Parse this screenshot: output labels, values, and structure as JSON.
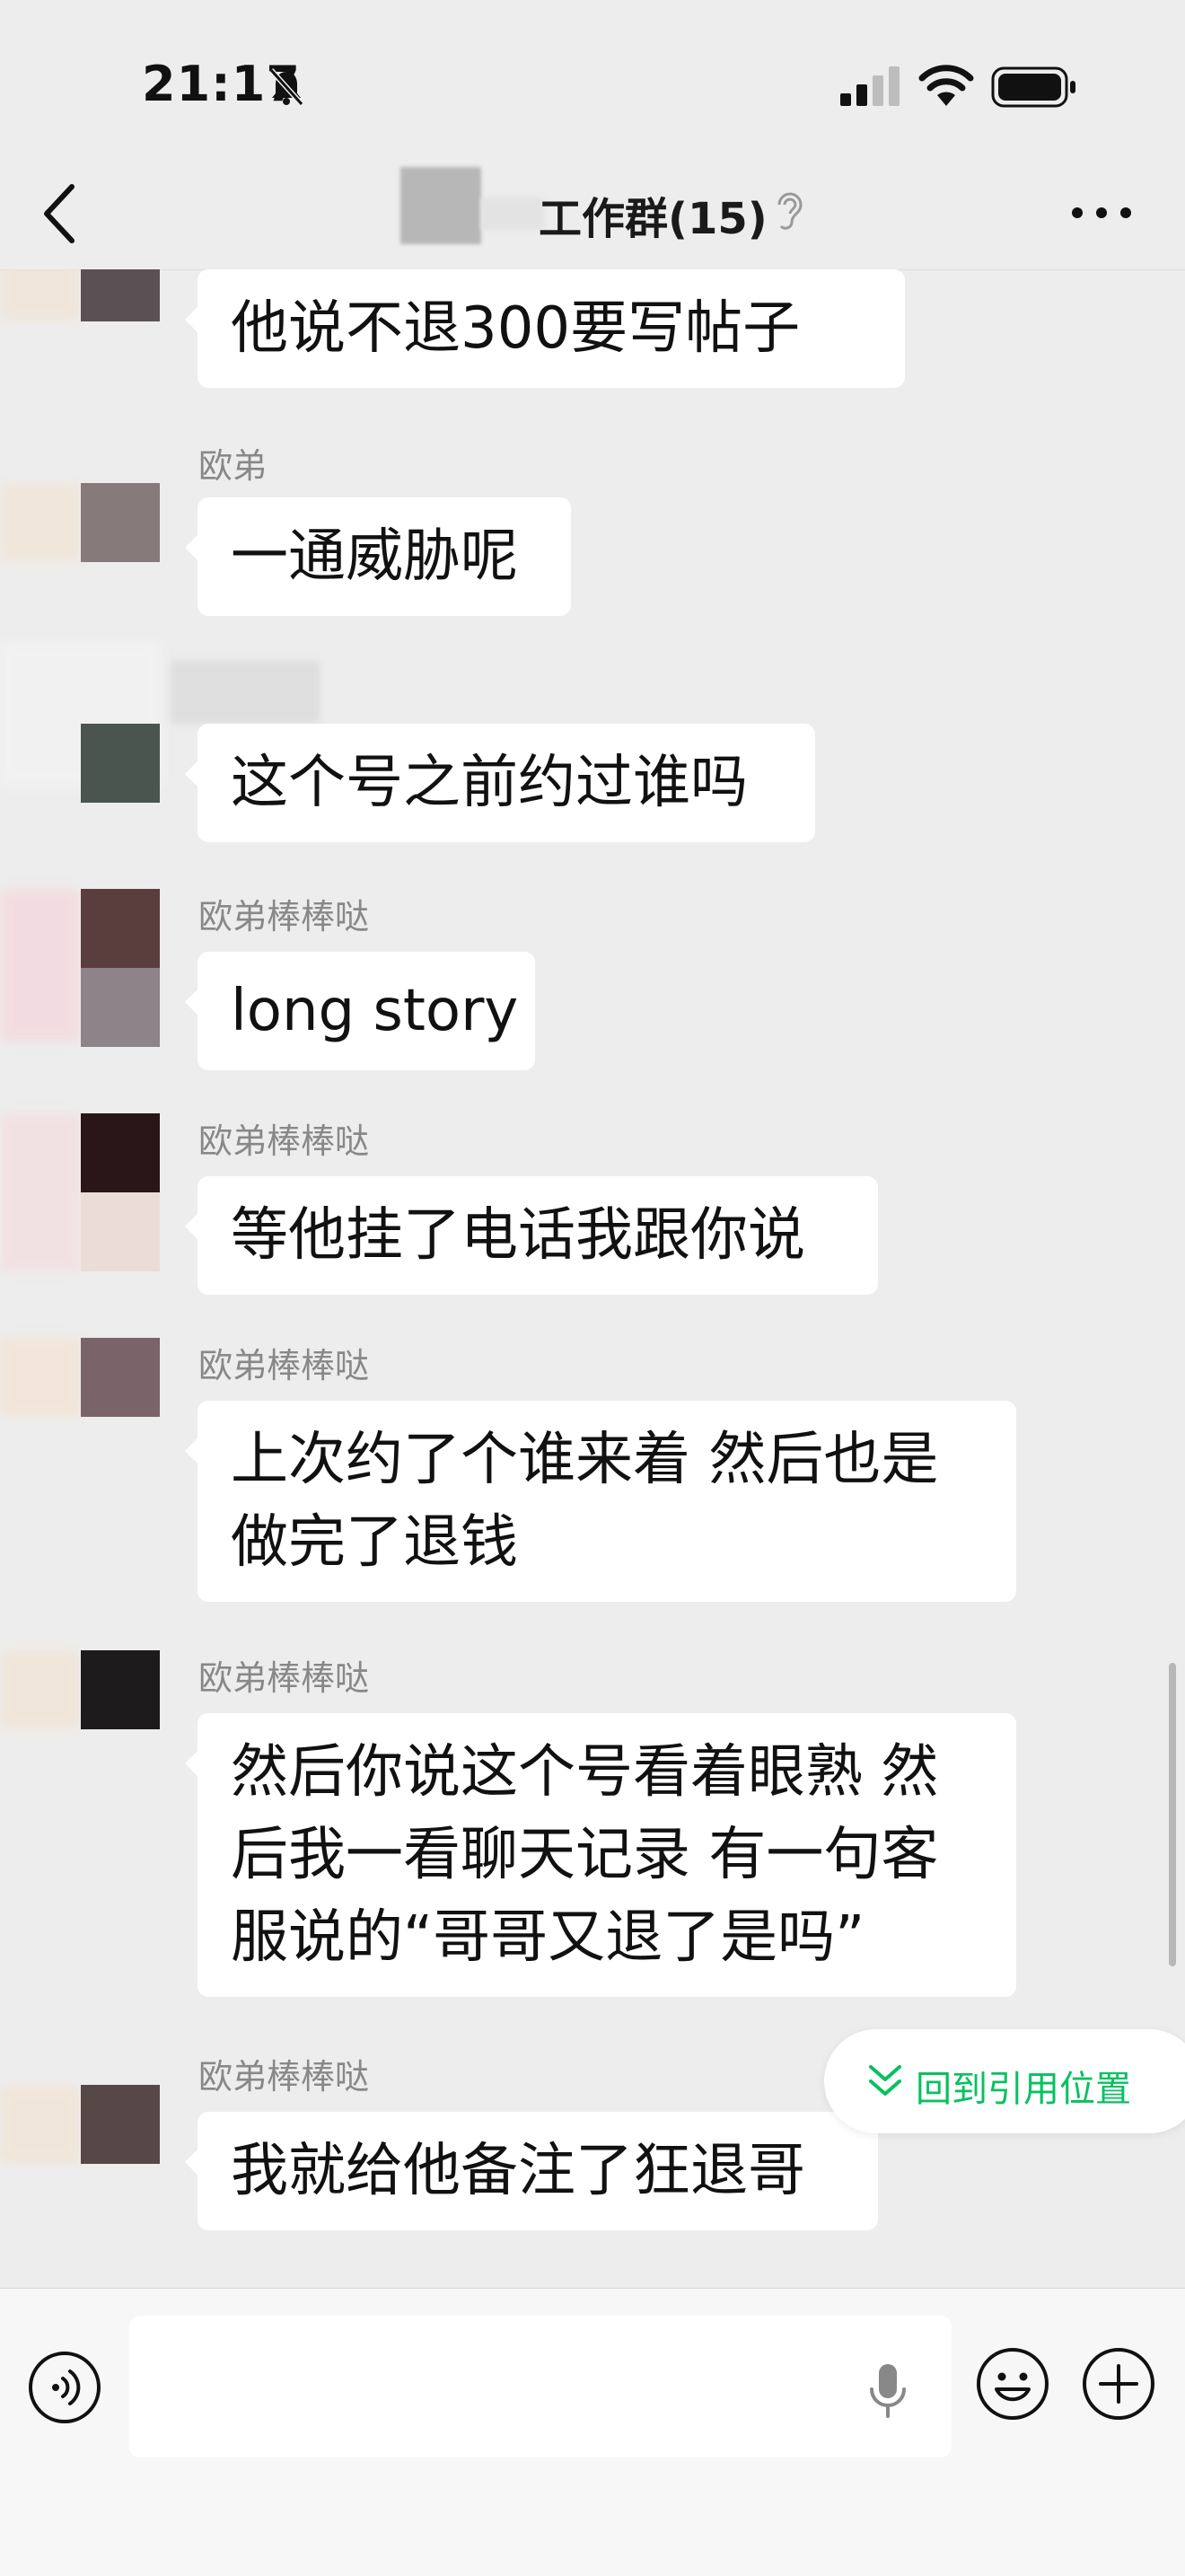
{
  "status_bar": {
    "time": "21:17"
  },
  "header": {
    "title": "工作群(15)",
    "title_visible": "工作群(15)"
  },
  "messages": [
    {
      "sender": "",
      "lines": [
        "他说不退300要写帖子"
      ]
    },
    {
      "sender": "欧弟",
      "lines": [
        "一通威胁呢"
      ]
    },
    {
      "sender": "",
      "lines": [
        "这个号之前约过谁吗"
      ]
    },
    {
      "sender": "欧弟棒棒哒",
      "lines": [
        "long story"
      ]
    },
    {
      "sender": "欧弟棒棒哒",
      "lines": [
        "等他挂了电话我跟你说"
      ]
    },
    {
      "sender": "欧弟棒棒哒",
      "lines": [
        "上次约了个谁来着 然后也是",
        "做完了退钱"
      ]
    },
    {
      "sender": "欧弟棒棒哒",
      "lines": [
        "然后你说这个号看着眼熟 然",
        "后我一看聊天记录 有一句客",
        "服说的“哥哥又退了是吗”"
      ]
    },
    {
      "sender": "欧弟棒棒哒",
      "lines": [
        "我就给他备注了狂退哥"
      ]
    }
  ],
  "jump_button": {
    "label": "回到引用位置"
  },
  "input": {
    "value": ""
  },
  "colors": {
    "accent": "#07c160",
    "background": "#ededed",
    "bubble": "#ffffff"
  },
  "icons": [
    "bell-muted-icon",
    "signal-icon",
    "wifi-icon",
    "battery-icon",
    "back-icon",
    "ear-icon",
    "more-icon",
    "voice-icon",
    "mic-icon",
    "emoji-icon",
    "plus-icon",
    "double-chevron-down-icon"
  ]
}
